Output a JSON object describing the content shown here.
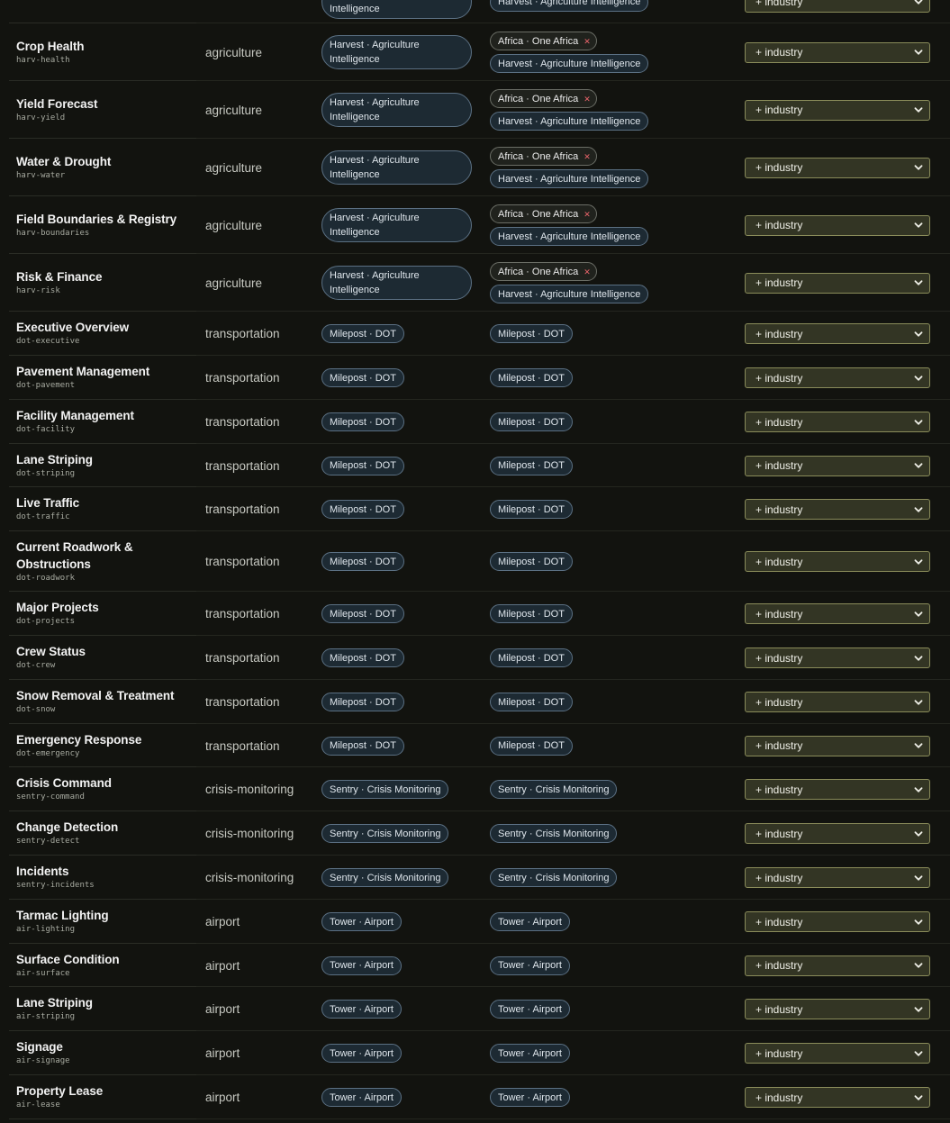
{
  "select_label": "+ industry",
  "rows": [
    {
      "name": "",
      "id": "",
      "category": "",
      "app": "Harvest · Agriculture Intelligence",
      "tags": [
        "Harvest · Agriculture Intelligence"
      ]
    },
    {
      "name": "Crop Health",
      "id": "harv-health",
      "category": "agriculture",
      "app": "Harvest · Agriculture Intelligence",
      "region": "Africa · One Africa",
      "tags": [
        "Harvest · Agriculture Intelligence"
      ]
    },
    {
      "name": "Yield Forecast",
      "id": "harv-yield",
      "category": "agriculture",
      "app": "Harvest · Agriculture Intelligence",
      "region": "Africa · One Africa",
      "tags": [
        "Harvest · Agriculture Intelligence"
      ]
    },
    {
      "name": "Water & Drought",
      "id": "harv-water",
      "category": "agriculture",
      "app": "Harvest · Agriculture Intelligence",
      "region": "Africa · One Africa",
      "tags": [
        "Harvest · Agriculture Intelligence"
      ]
    },
    {
      "name": "Field Boundaries & Registry",
      "id": "harv-boundaries",
      "category": "agriculture",
      "app": "Harvest · Agriculture Intelligence",
      "region": "Africa · One Africa",
      "tags": [
        "Harvest · Agriculture Intelligence"
      ]
    },
    {
      "name": "Risk & Finance",
      "id": "harv-risk",
      "category": "agriculture",
      "app": "Harvest · Agriculture Intelligence",
      "region": "Africa · One Africa",
      "tags": [
        "Harvest · Agriculture Intelligence"
      ]
    },
    {
      "name": "Executive Overview",
      "id": "dot-executive",
      "category": "transportation",
      "app": "Milepost · DOT",
      "tags": [
        "Milepost · DOT"
      ]
    },
    {
      "name": "Pavement Management",
      "id": "dot-pavement",
      "category": "transportation",
      "app": "Milepost · DOT",
      "tags": [
        "Milepost · DOT"
      ]
    },
    {
      "name": "Facility Management",
      "id": "dot-facility",
      "category": "transportation",
      "app": "Milepost · DOT",
      "tags": [
        "Milepost · DOT"
      ]
    },
    {
      "name": "Lane Striping",
      "id": "dot-striping",
      "category": "transportation",
      "app": "Milepost · DOT",
      "tags": [
        "Milepost · DOT"
      ]
    },
    {
      "name": "Live Traffic",
      "id": "dot-traffic",
      "category": "transportation",
      "app": "Milepost · DOT",
      "tags": [
        "Milepost · DOT"
      ]
    },
    {
      "name": "Current Roadwork & Obstructions",
      "id": "dot-roadwork",
      "category": "transportation",
      "app": "Milepost · DOT",
      "tags": [
        "Milepost · DOT"
      ]
    },
    {
      "name": "Major Projects",
      "id": "dot-projects",
      "category": "transportation",
      "app": "Milepost · DOT",
      "tags": [
        "Milepost · DOT"
      ]
    },
    {
      "name": "Crew Status",
      "id": "dot-crew",
      "category": "transportation",
      "app": "Milepost · DOT",
      "tags": [
        "Milepost · DOT"
      ]
    },
    {
      "name": "Snow Removal & Treatment",
      "id": "dot-snow",
      "category": "transportation",
      "app": "Milepost · DOT",
      "tags": [
        "Milepost · DOT"
      ]
    },
    {
      "name": "Emergency Response",
      "id": "dot-emergency",
      "category": "transportation",
      "app": "Milepost · DOT",
      "tags": [
        "Milepost · DOT"
      ]
    },
    {
      "name": "Crisis Command",
      "id": "sentry-command",
      "category": "crisis-monitoring",
      "app": "Sentry · Crisis Monitoring",
      "tags": [
        "Sentry · Crisis Monitoring"
      ]
    },
    {
      "name": "Change Detection",
      "id": "sentry-detect",
      "category": "crisis-monitoring",
      "app": "Sentry · Crisis Monitoring",
      "tags": [
        "Sentry · Crisis Monitoring"
      ]
    },
    {
      "name": "Incidents",
      "id": "sentry-incidents",
      "category": "crisis-monitoring",
      "app": "Sentry · Crisis Monitoring",
      "tags": [
        "Sentry · Crisis Monitoring"
      ]
    },
    {
      "name": "Tarmac Lighting",
      "id": "air-lighting",
      "category": "airport",
      "app": "Tower · Airport",
      "tags": [
        "Tower · Airport"
      ]
    },
    {
      "name": "Surface Condition",
      "id": "air-surface",
      "category": "airport",
      "app": "Tower · Airport",
      "tags": [
        "Tower · Airport"
      ]
    },
    {
      "name": "Lane Striping",
      "id": "air-striping",
      "category": "airport",
      "app": "Tower · Airport",
      "tags": [
        "Tower · Airport"
      ]
    },
    {
      "name": "Signage",
      "id": "air-signage",
      "category": "airport",
      "app": "Tower · Airport",
      "tags": [
        "Tower · Airport"
      ]
    },
    {
      "name": "Property Lease",
      "id": "air-lease",
      "category": "airport",
      "app": "Tower · Airport",
      "tags": [
        "Tower · Airport"
      ]
    }
  ]
}
